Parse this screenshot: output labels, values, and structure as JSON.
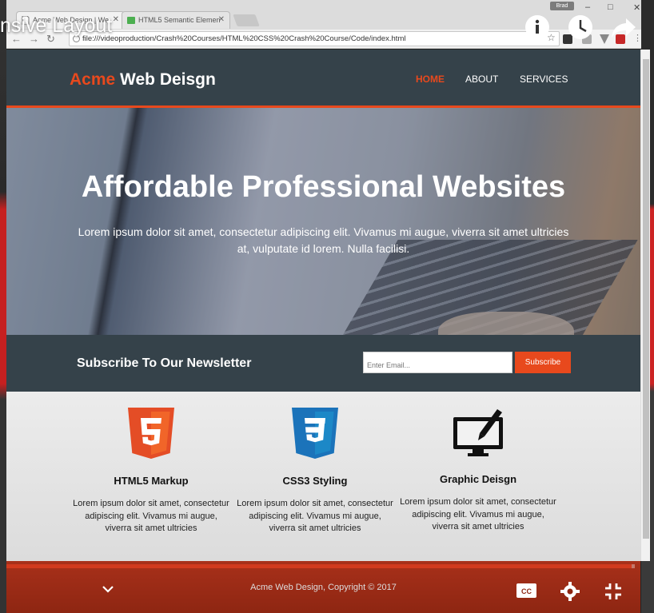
{
  "video": {
    "title": "nsive Layout",
    "overlay_icons": [
      "info-icon",
      "watch-later-icon",
      "share-icon"
    ],
    "progress_fraction": 0.995,
    "controls": [
      "chevron-down-icon",
      "captions-icon",
      "settings-icon",
      "exit-fullscreen-icon"
    ]
  },
  "browser": {
    "tabs": [
      {
        "label": "Acme Web Design | We",
        "icon": "page-icon"
      },
      {
        "label": "HTML5 Semantic Elemen",
        "icon": "puzzle-icon"
      }
    ],
    "user_badge": "Brad",
    "url": "file:///videoproduction/Crash%20Courses/HTML%20CSS%20Crash%20Course/Code/index.html"
  },
  "site": {
    "brand_highlight": "Acme",
    "brand_rest": " Web Deisgn",
    "nav": [
      {
        "label": "HOME",
        "active": true
      },
      {
        "label": "ABOUT",
        "active": false
      },
      {
        "label": "SERVICES",
        "active": false
      }
    ],
    "showcase": {
      "title": "Affordable Professional Websites",
      "text": "Lorem ipsum dolor sit amet, consectetur adipiscing elit. Vivamus mi augue, viverra sit amet ultricies at, vulputate id lorem. Nulla facilisi."
    },
    "newsletter": {
      "title": "Subscribe To Our Newsletter",
      "email_placeholder": "Enter Email...",
      "button_label": "Subscribe"
    },
    "boxes": [
      {
        "icon": "html5-icon",
        "title": "HTML5 Markup",
        "text": "Lorem ipsum dolor sit amet, consectetur adipiscing elit. Vivamus mi augue, viverra sit amet ultricies"
      },
      {
        "icon": "css3-icon",
        "title": "CSS3 Styling",
        "text": "Lorem ipsum dolor sit amet, consectetur adipiscing elit. Vivamus mi augue, viverra sit amet ultricies"
      },
      {
        "icon": "graphic-design-icon",
        "title": "Graphic Deisgn",
        "text": "Lorem ipsum dolor sit amet, consectetur adipiscing elit. Vivamus mi augue, viverra sit amet ultricies"
      }
    ],
    "footer": "Acme Web Design, Copyright © 2017"
  },
  "colors": {
    "accent": "#e8491d",
    "dark": "#35424a",
    "footer": "#a8301a"
  }
}
